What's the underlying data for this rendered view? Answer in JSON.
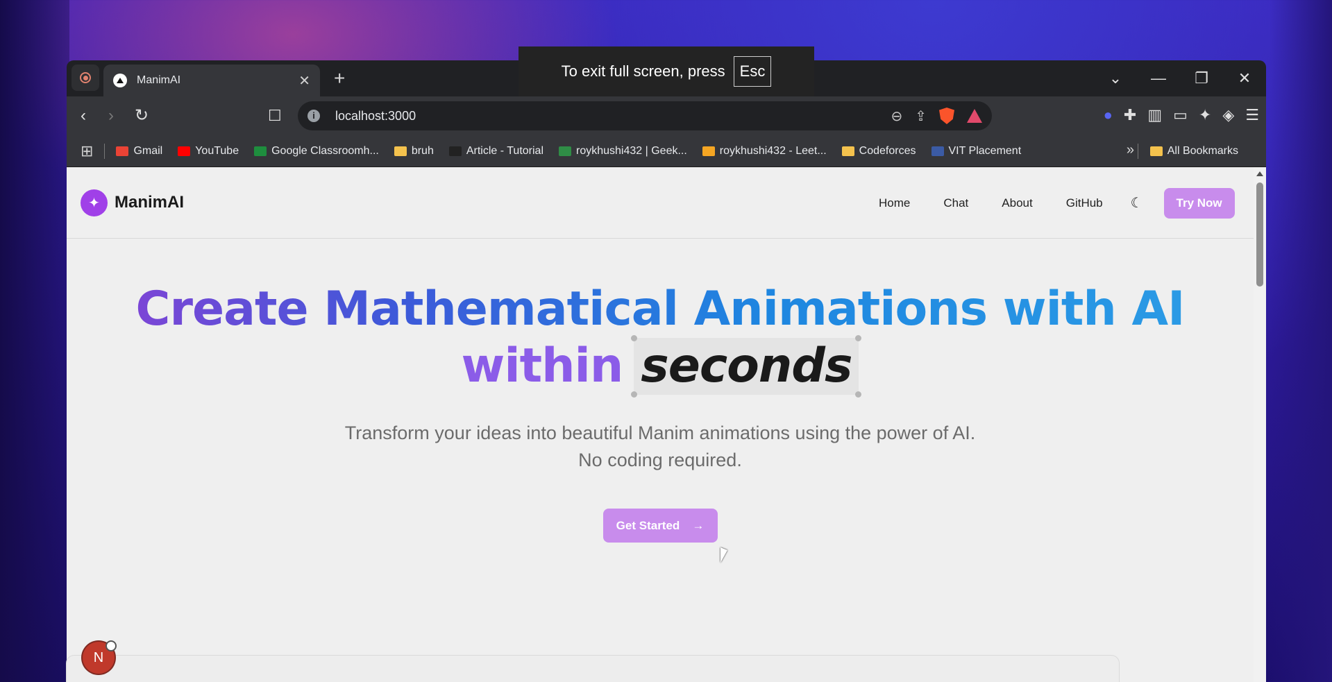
{
  "fullscreen_notice": {
    "text": "To exit full screen, press",
    "key": "Esc"
  },
  "browser": {
    "tab": {
      "title": "ManimAI"
    },
    "address": "localhost:3000",
    "bookmarks": [
      {
        "label": "Gmail",
        "color": "#ea4335"
      },
      {
        "label": "YouTube",
        "color": "#ff0000"
      },
      {
        "label": "Google Classroomh...",
        "color": "#1e8e3e"
      },
      {
        "label": "bruh",
        "color": "#f4c24d"
      },
      {
        "label": "Article - Tutorial",
        "color": "#222222"
      },
      {
        "label": "roykhushi432 | Geek...",
        "color": "#2f8d46"
      },
      {
        "label": "roykhushi432 - Leet...",
        "color": "#f5a623"
      },
      {
        "label": "Codeforces",
        "color": "#f4c24d"
      },
      {
        "label": "VIT Placement",
        "color": "#3b5ba5"
      }
    ],
    "all_bookmarks": "All Bookmarks"
  },
  "page": {
    "brand": "ManimAI",
    "nav": {
      "home": "Home",
      "chat": "Chat",
      "about": "About",
      "github": "GitHub",
      "try_now": "Try Now"
    },
    "hero": {
      "title_line1": "Create Mathematical Animations with AI",
      "title_within": "within",
      "title_seconds": "seconds",
      "subtitle": "Transform your ideas into beautiful Manim animations using the power of AI. No coding required.",
      "cta": "Get Started"
    },
    "avatar_letter": "N"
  },
  "colors": {
    "accent": "#c88cec",
    "brand": "#a040e8"
  }
}
